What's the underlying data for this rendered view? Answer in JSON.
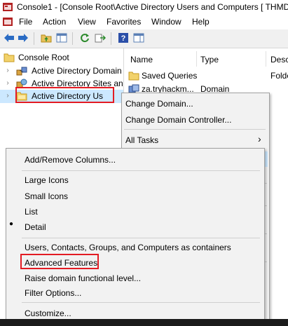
{
  "window": {
    "title": "Console1 - [Console Root\\Active Directory Users and Computers [ THMDC"
  },
  "menubar": {
    "items": [
      "File",
      "Action",
      "View",
      "Favorites",
      "Window",
      "Help"
    ]
  },
  "tree": {
    "root": "Console Root",
    "items": [
      {
        "label": "Active Directory Domain"
      },
      {
        "label": "Active Directory Sites an"
      },
      {
        "label": "Active Directory Us"
      }
    ]
  },
  "list": {
    "columns": [
      "Name",
      "Type",
      "Desc"
    ],
    "rows": [
      {
        "name": "Saved Queries",
        "type": "",
        "desc": "Folde"
      },
      {
        "name": "za.tryhackm...",
        "type": "Domain",
        "desc": ""
      }
    ]
  },
  "context_menu": {
    "items": [
      "Change Domain...",
      "Change Domain Controller...",
      "All Tasks"
    ],
    "all_tasks_arrow": "›"
  },
  "view_submenu": {
    "items": [
      "Add/Remove Columns...",
      "Large Icons",
      "Small Icons",
      "List",
      "Detail",
      "Users, Contacts, Groups, and Computers as containers",
      "Advanced Features",
      "Raise domain functional level...",
      "Filter Options...",
      "Customize..."
    ],
    "checked_bullet": "●"
  }
}
